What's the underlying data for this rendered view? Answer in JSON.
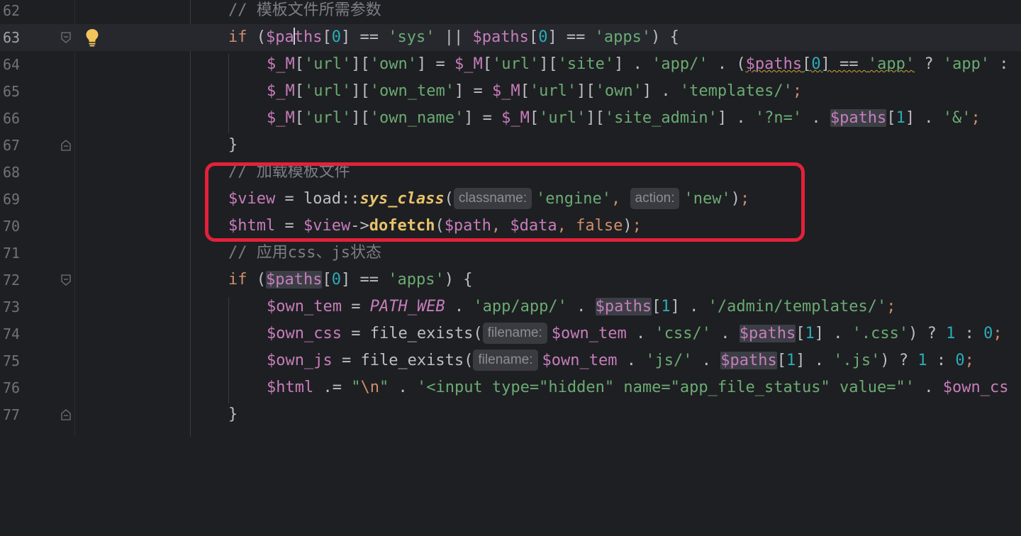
{
  "editor": {
    "current_line": 63,
    "lines": [
      {
        "num": "62",
        "comment": "// 模板文件所需参数"
      },
      {
        "num": "63"
      },
      {
        "num": "64"
      },
      {
        "num": "65"
      },
      {
        "num": "66"
      },
      {
        "num": "67",
        "text": "}"
      },
      {
        "num": "68",
        "comment": "// 加载模板文件"
      },
      {
        "num": "69"
      },
      {
        "num": "70"
      },
      {
        "num": "71",
        "comment": "// 应用css、js状态"
      },
      {
        "num": "72"
      },
      {
        "num": "73"
      },
      {
        "num": "74"
      },
      {
        "num": "75"
      },
      {
        "num": "76"
      },
      {
        "num": "77",
        "text": "}"
      }
    ],
    "hints": {
      "classname": "classname:",
      "action": "action:",
      "filename_74": "filename:",
      "filename_75": "filename:"
    }
  },
  "colors": {
    "background": "#1e1f22",
    "keyword": "#cf8e6d",
    "variable": "#c77dbb",
    "string": "#6aab73",
    "number": "#2aacb8",
    "comment": "#7a7e85",
    "function": "#e8c26b",
    "highlight_box": "#e3213a"
  },
  "icons": {
    "intention": "lightbulb-icon",
    "fold": "fold-marker-icon"
  }
}
